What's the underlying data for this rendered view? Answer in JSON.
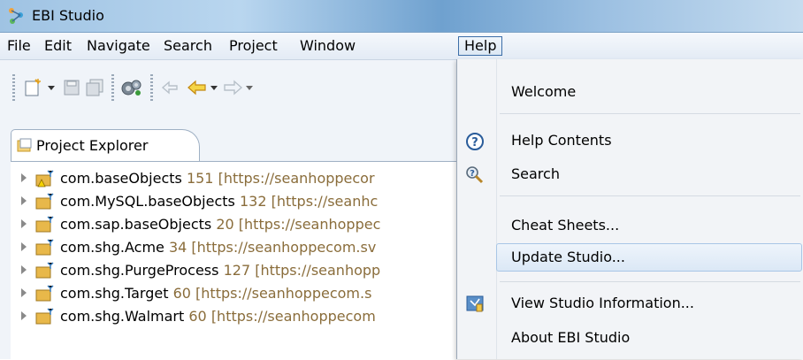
{
  "window": {
    "title": "EBI Studio"
  },
  "menubar": {
    "items": [
      {
        "label": "File"
      },
      {
        "label": "Edit"
      },
      {
        "label": "Navigate"
      },
      {
        "label": "Search"
      },
      {
        "label": "Project"
      },
      {
        "label": "Window"
      },
      {
        "label": "Help"
      }
    ]
  },
  "explorer": {
    "tab_label": "Project Explorer",
    "rows": [
      {
        "name": "com.baseObjects",
        "count": "151",
        "url": "[https://seanhoppecor"
      },
      {
        "name": "com.MySQL.baseObjects",
        "count": "132",
        "url": "[https://seanhc"
      },
      {
        "name": "com.sap.baseObjects",
        "count": "20",
        "url": "[https://seanhoppec"
      },
      {
        "name": "com.shg.Acme",
        "count": "34",
        "url": "[https://seanhoppecom.sv"
      },
      {
        "name": "com.shg.PurgeProcess",
        "count": "127",
        "url": "[https://seanhopp"
      },
      {
        "name": "com.shg.Target",
        "count": "60",
        "url": "[https://seanhoppecom.s"
      },
      {
        "name": "com.shg.Walmart",
        "count": "60",
        "url": "[https://seanhoppecom"
      }
    ]
  },
  "help_menu": {
    "welcome": "Welcome",
    "help_contents": "Help Contents",
    "search": "Search",
    "cheat_sheets": "Cheat Sheets...",
    "update_studio": "Update Studio...",
    "view_info": "View Studio Information...",
    "about": "About EBI Studio"
  },
  "colors": {
    "menu_highlight": "#dbe8f6",
    "active_menu_border": "#3c6ea8",
    "decoration_text": "#8a6d3b"
  }
}
